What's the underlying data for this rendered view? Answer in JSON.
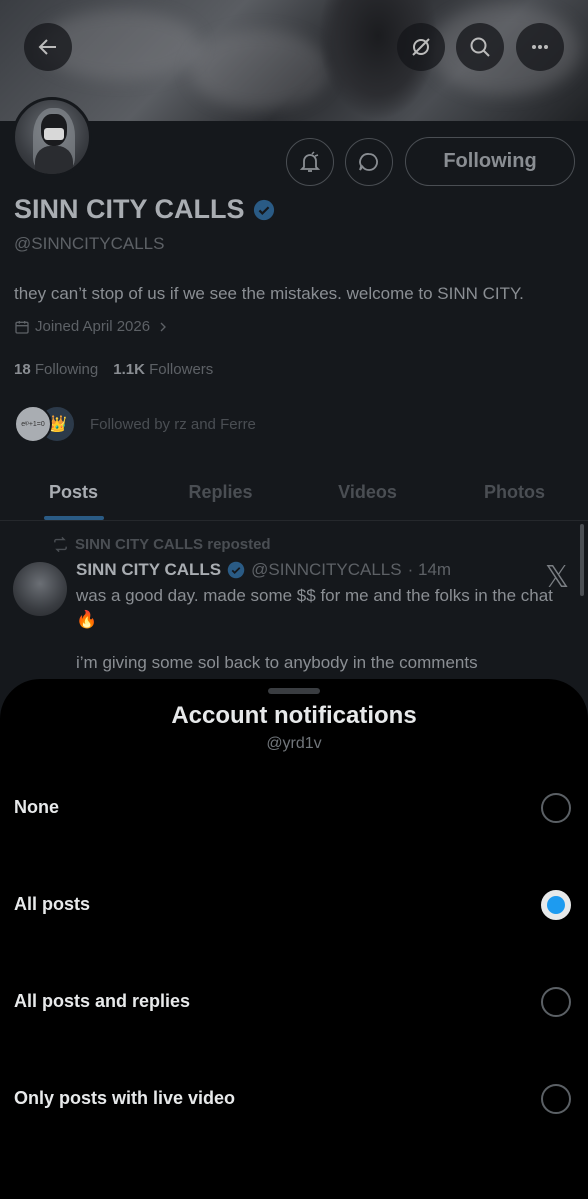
{
  "profile": {
    "display_name": "SINN CITY CALLS",
    "handle": "@SINNCITYCALLS",
    "bio": "they can’t stop of us if we see the mistakes. welcome to SINN CITY.",
    "joined": "Joined April 2026",
    "following_count": "18",
    "following_label": "Following",
    "followers_count": "1.1K",
    "followers_label": "Followers",
    "followed_by": "Followed by rz and Ferre",
    "follow_button": "Following"
  },
  "tabs": [
    {
      "label": "Posts"
    },
    {
      "label": "Replies"
    },
    {
      "label": "Videos"
    },
    {
      "label": "Photos"
    }
  ],
  "post": {
    "repost_label": "SINN CITY CALLS reposted",
    "author_name": "SINN CITY CALLS",
    "author_handle": "@SINNCITYCALLS",
    "time": "· 14m",
    "text": "was a good day. made some $$ for me and the folks in the chat 🔥",
    "text2": "i’m giving some sol back to anybody in the comments",
    "x_glyph": "𝕏"
  },
  "sheet": {
    "title": "Account notifications",
    "subtitle": "@yrd1v",
    "options": [
      {
        "label": "None",
        "selected": false
      },
      {
        "label": "All posts",
        "selected": true
      },
      {
        "label": "All posts and replies",
        "selected": false
      },
      {
        "label": "Only posts with live video",
        "selected": false
      }
    ]
  },
  "mini_avatar_text": "eᶦᵖ+1=0",
  "mini_avatar_emoji": "👑",
  "colors": {
    "accent": "#1d9bf0",
    "sheet_bg": "#000000",
    "dim_bg": "#15181c"
  }
}
